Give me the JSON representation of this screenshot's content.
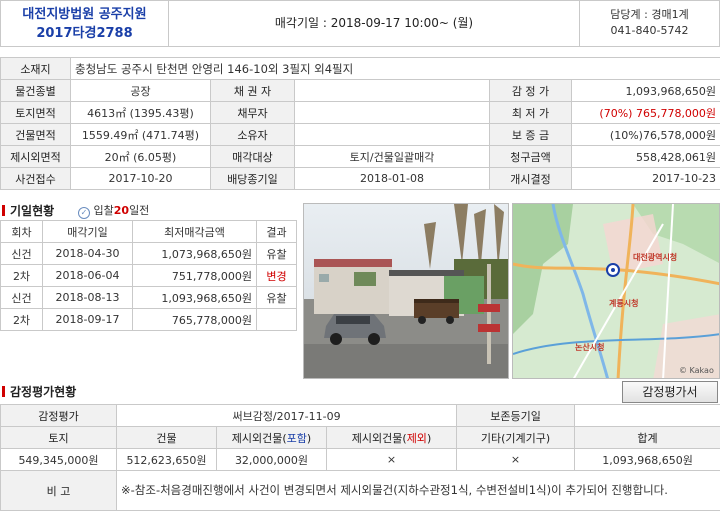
{
  "header": {
    "court": "대전지방법원 공주지원",
    "case_no": "2017타경2788",
    "auction_label": "매각기일 : 2018-09-17   10:00~ (월)",
    "dept": "담당계 : 경매1계",
    "phone": "041-840-5742"
  },
  "info": {
    "address_label": "소재지",
    "address": "충청남도 공주시 탄천면 안영리 146-10외 3필지",
    "address_extra": "외4필지",
    "rows": [
      [
        "물건종별",
        "공장",
        "채 권 자",
        "",
        "감 정 가",
        "1,093,968,650원"
      ],
      [
        "토지면적",
        "4613㎡ (1395.43평)",
        "채무자",
        "",
        "최 저 가",
        "(70%) 765,778,000원"
      ],
      [
        "건물면적",
        "1559.49㎡ (471.74평)",
        "소유자",
        "",
        "보 증 금",
        "(10%)76,578,000원"
      ],
      [
        "제시외면적",
        "20㎡ (6.05평)",
        "매각대상",
        "토지/건물일괄매각",
        "청구금액",
        "558,428,061원"
      ],
      [
        "사건접수",
        "2017-10-20",
        "배당종기일",
        "2018-01-08",
        "개시결정",
        "2017-10-23"
      ]
    ]
  },
  "history": {
    "title": "기일현황",
    "badge_prefix": "입찰",
    "badge_num": "20",
    "badge_suffix": "일전",
    "headers": [
      "회차",
      "매각기일",
      "최저매각금액",
      "결과"
    ],
    "rows": [
      [
        "신건",
        "2018-04-30",
        "1,073,968,650원",
        "유찰"
      ],
      [
        "2차",
        "2018-06-04",
        "751,778,000원",
        "변경"
      ],
      [
        "신건",
        "2018-08-13",
        "1,093,968,650원",
        "유찰"
      ],
      [
        "2차",
        "2018-09-17",
        "765,778,000원",
        ""
      ]
    ]
  },
  "map": {
    "labels": [
      "대전광역시청",
      "계룡시청",
      "논산시청"
    ],
    "copyright": "© Kakao"
  },
  "appraisal": {
    "title": "감정평가현황",
    "button": "감정평가서",
    "row1": [
      "감정평가",
      "써브감정/2017-11-09",
      "보존등기일",
      ""
    ],
    "headers_pre": [
      "토지",
      "건물"
    ],
    "header_incl_a": "제시외건물(",
    "header_incl_b": "포함",
    "header_incl_c": ")",
    "header_excl_a": "제시외건물(",
    "header_excl_b": "제외",
    "header_excl_c": ")",
    "headers_post": [
      "기타(기계기구)",
      "합계"
    ],
    "values": [
      "549,345,000원",
      "512,623,650원",
      "32,000,000원",
      "×",
      "×",
      "1,093,968,650원"
    ],
    "note_label": "비 고",
    "note": "※-참조-처음경매진행에서 사건이 변경되면서 제시외물건(지하수관정1식, 수변전설비1식)이 추가되어 진행합니다."
  },
  "colors": {
    "accent_red": "#d00000",
    "accent_blue": "#1a3fa8",
    "header_bg": "#f1f1f1"
  }
}
